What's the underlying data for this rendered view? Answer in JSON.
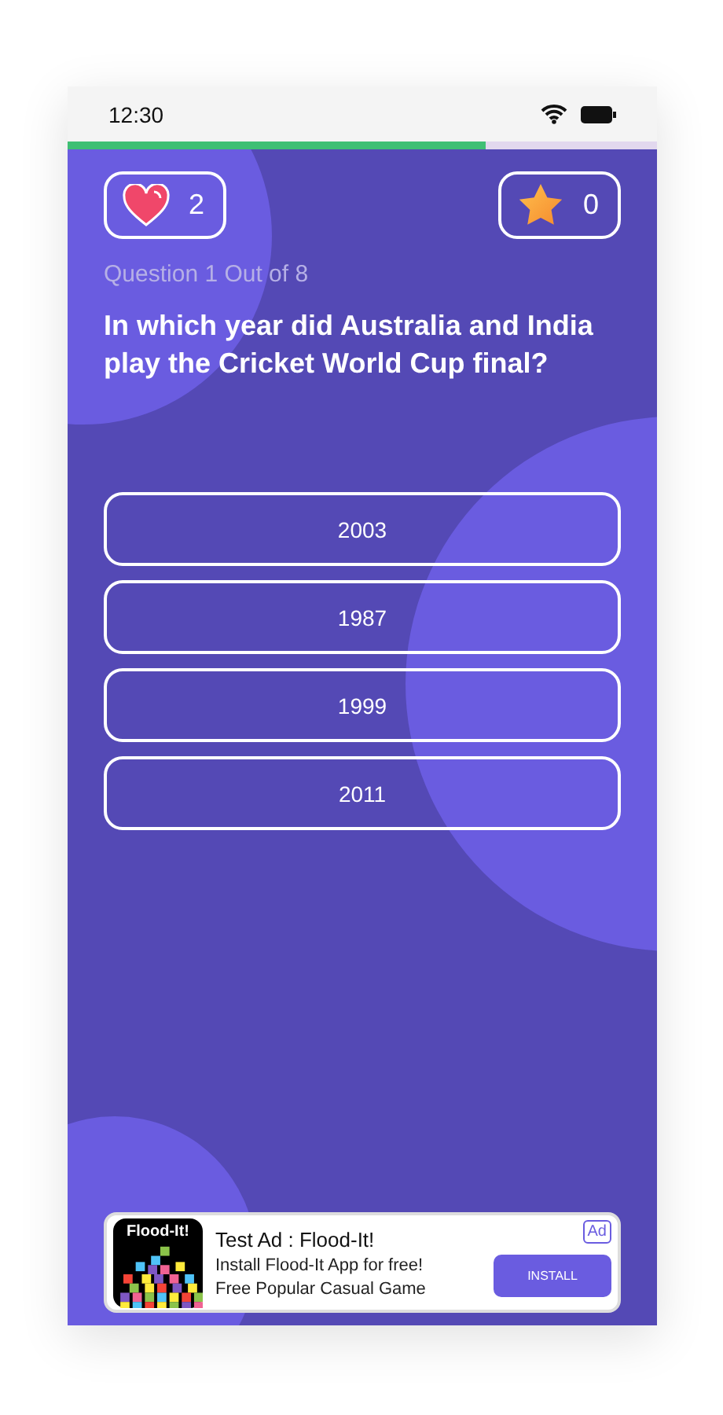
{
  "status_bar": {
    "time": "12:30"
  },
  "progress": {
    "level": 0.71
  },
  "lives": {
    "count": "2"
  },
  "score": {
    "count": "0"
  },
  "question": {
    "counter": "Question 1 Out of 8",
    "text": "In which year did Australia and India play the Cricket World Cup final?"
  },
  "answers": [
    {
      "label": "2003",
      "selected": false
    },
    {
      "label": "1987",
      "selected": false
    },
    {
      "label": "1999",
      "selected": false
    },
    {
      "label": "2011",
      "selected": false
    }
  ],
  "ad": {
    "icon_label": "Flood-It!",
    "title": "Test Ad : Flood-It!",
    "badge": "Ad",
    "lines": [
      "Install Flood-It App for free!",
      "Free Popular Casual Game"
    ],
    "button": "INSTALL"
  }
}
